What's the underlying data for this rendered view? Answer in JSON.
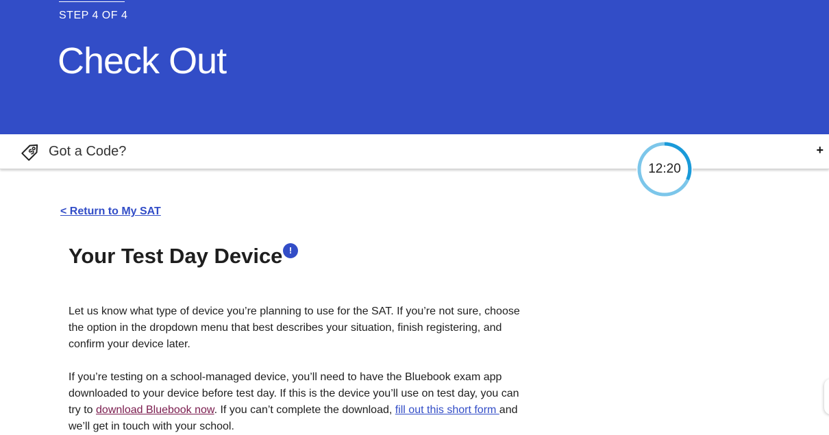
{
  "header": {
    "step": "STEP 4 OF 4",
    "title": "Check Out",
    "background_color": "#324dc7"
  },
  "promo": {
    "label": "Got a Code?",
    "icon": "price-tag-dollar-icon",
    "expand_icon": "+"
  },
  "timer": {
    "value": "12:20",
    "ring_color": "#1a9ad9",
    "ring_remaining_color": "#7cc6ea"
  },
  "nav": {
    "return_link": "< Return to My SAT"
  },
  "device_section": {
    "title": "Your Test Day Device",
    "info_icon": "!",
    "paragraph1": "Let us know what type of device you’re planning to use for the SAT. If you’re not sure, choose the option in the dropdown menu that best describes your situation, finish registering, and confirm your device later.",
    "paragraph2": {
      "part1": "If you’re testing on a school-managed device, you’ll need to have the Bluebook exam app downloaded to your device before test day. If this is the device you’ll use on test day, you can try to ",
      "link1": "download Bluebook now",
      "part2": ". If you can’t complete the download, ",
      "link2": "fill out this short form ",
      "part3": "and we’ll get in touch with your school."
    }
  }
}
